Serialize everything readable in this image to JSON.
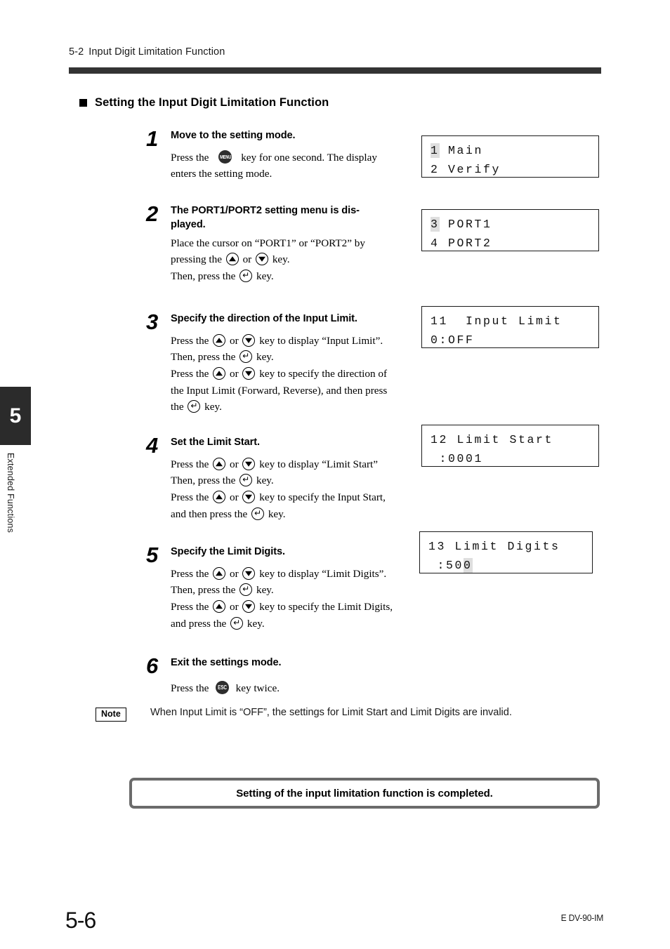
{
  "header": {
    "section_number": "5-2",
    "section_title": "Input Digit Limitation Function"
  },
  "chapter_tab": {
    "number": "5",
    "label": "Extended Functions"
  },
  "section_heading": "Setting the Input Digit Limitation Function",
  "steps": [
    {
      "number": "1",
      "title": "Move to the setting mode.",
      "paragraphs": [
        "Press the  ⓘ  key for one second. The display enters the setting mode."
      ]
    },
    {
      "number": "2",
      "title": "The PORT1/PORT2 setting menu is dis-played.",
      "paragraphs": [
        "Place the cursor on “PORT1” or “PORT2” by pressing the ▲ or ▼ key.",
        "Then, press the ↵ key."
      ]
    },
    {
      "number": "3",
      "title": "Specify the direction of the Input Limit.",
      "paragraphs": [
        "Press the ▲ or ▼ key to display “Input Limit”. Then, press the ↵ key.",
        "Press the ▲ or ▼ key to specify the direction of the Input Limit (Forward, Reverse), and then press the ↵ key."
      ]
    },
    {
      "number": "4",
      "title": "Set the Limit Start.",
      "paragraphs": [
        "Press the ▲ or ▼ key to display “Limit Start” Then, press the ↵ key.",
        "Press the ▲ or ▼ key to specify the Input Start, and then press the ↵ key."
      ]
    },
    {
      "number": "5",
      "title": "Specify the Limit Digits.",
      "paragraphs": [
        "Press the ▲ or ▼ key to display “Limit Digits”. Then, press the ↵ key.",
        "Press the ▲ or ▼ key to specify the Limit Digits, and press the ↵ key."
      ]
    },
    {
      "number": "6",
      "title": "Exit the settings mode.",
      "paragraphs": [
        "Press the  ESC  key twice."
      ]
    }
  ],
  "step_text": {
    "s1_l1_a": "Press the",
    "s1_l1_b": "key for one second. The display",
    "s1_l2": "enters the setting mode.",
    "s2_l1": "Place the cursor on “PORT1” or “PORT2” by",
    "s2_l2_a": "pressing the",
    "s2_l2_b": "or",
    "s2_l2_c": "key.",
    "s2_l3_a": "Then, press the",
    "s2_l3_b": "key.",
    "s3_l1_a": "Press the",
    "s3_l1_b": "or",
    "s3_l1_c": "key to display “Input Limit”.",
    "s3_l2_a": "Then, press the",
    "s3_l2_b": "key.",
    "s3_l3_a": "Press the",
    "s3_l3_b": "or",
    "s3_l3_c": "key to specify the direction of",
    "s3_l4": "the Input Limit (Forward, Reverse), and then press",
    "s3_l5_a": "the",
    "s3_l5_b": "key.",
    "s4_l1_a": "Press the",
    "s4_l1_b": "or",
    "s4_l1_c": "key to display “Limit Start”",
    "s4_l2_a": "Then, press the",
    "s4_l2_b": "key.",
    "s4_l3_a": "Press the",
    "s4_l3_b": "or",
    "s4_l3_c": "key to specify the Input Start,",
    "s4_l4_a": "and then press the",
    "s4_l4_b": "key.",
    "s5_l1_a": "Press the",
    "s5_l1_b": "or",
    "s5_l1_c": "key to display “Limit Digits”.",
    "s5_l2_a": "Then, press the",
    "s5_l2_b": "key.",
    "s5_l3_a": "Press the",
    "s5_l3_b": "or",
    "s5_l3_c": "key to specify the Limit Digits,",
    "s5_l4_a": "and press the",
    "s5_l4_b": "key.",
    "s6_l1_a": "Press the",
    "s6_l1_b": "key twice."
  },
  "keys": {
    "menu_label": "MENU",
    "esc_label": "ESC",
    "enter_glyph": "↵"
  },
  "lcd_screens": [
    {
      "id": "lcd-main-verify",
      "line1_cursor": "1",
      "line1_text": "Main",
      "line2_cursor": "2",
      "line2_text": "Verify"
    },
    {
      "id": "lcd-port",
      "line1_cursor": "3",
      "line1_text": "PORT1",
      "line2_cursor": "4",
      "line2_text": "PORT2"
    },
    {
      "id": "lcd-input-limit",
      "line1_text": "11  Input Limit",
      "line2_text": "0:OFF"
    },
    {
      "id": "lcd-limit-start",
      "line1_text": "12 Limit Start",
      "line2_text": " :0001"
    },
    {
      "id": "lcd-limit-digits",
      "line1_text": "13 Limit Digits",
      "line2_prefix": " :50",
      "line2_cursor": "0"
    }
  ],
  "note": {
    "badge": "Note",
    "text": "When Input Limit is “OFF”, the settings for Limit Start and Limit Digits are invalid."
  },
  "completion_banner": "Setting of the input limitation function is completed.",
  "footer": {
    "page_number": "5-6",
    "document_code": "E DV-90-IM"
  },
  "colors": {
    "rule": "#333333",
    "tab": "#2b2b2b",
    "lcd_border": "#1a1a1a",
    "lcd_cursor": "#dedede",
    "banner_border": "#6b6b6b"
  }
}
